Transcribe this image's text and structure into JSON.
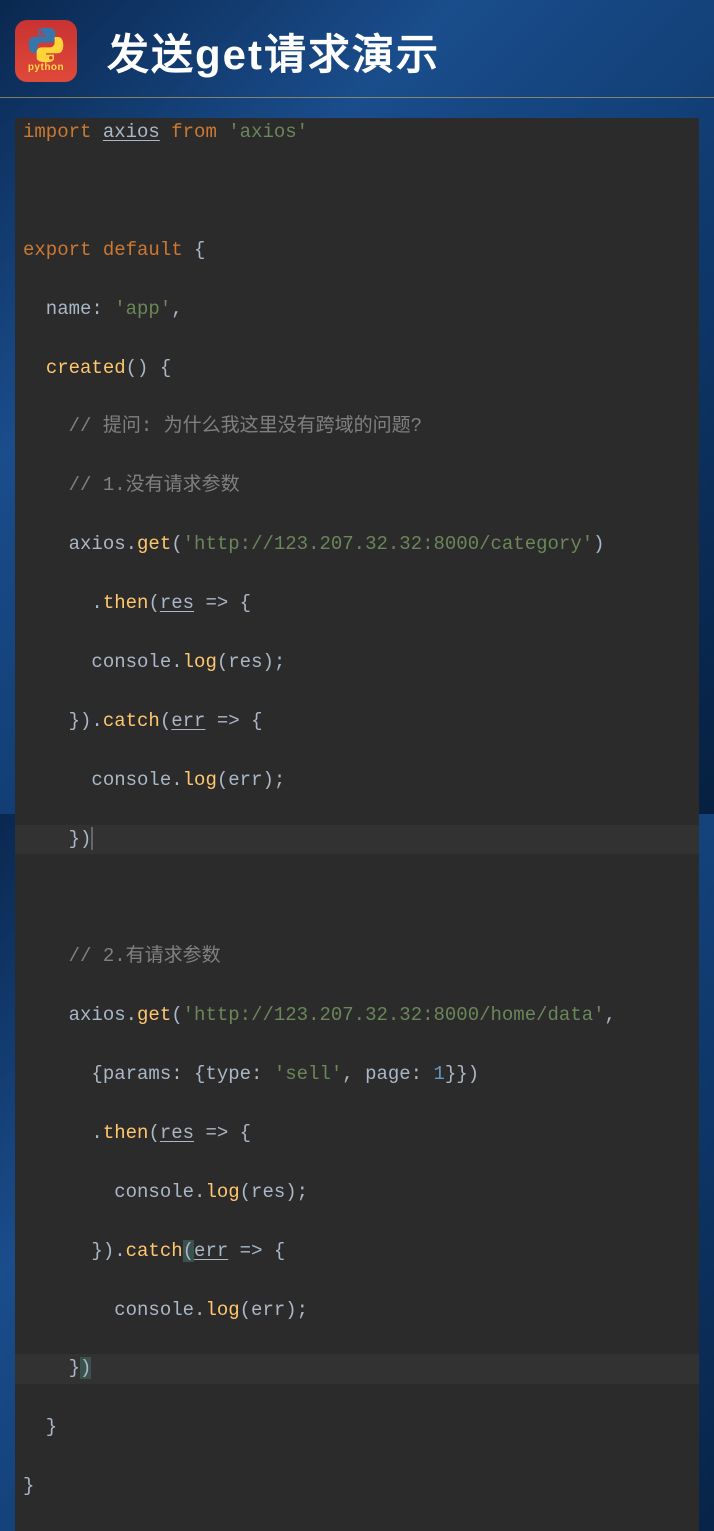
{
  "header": {
    "logo_text": "python",
    "title": "发送get请求演示"
  },
  "code": {
    "lines": [
      {
        "type": "code",
        "tokens": [
          {
            "cls": "kw",
            "t": "import "
          },
          {
            "cls": "ident underline",
            "t": "axios"
          },
          {
            "cls": "kw",
            "t": " from "
          },
          {
            "cls": "str",
            "t": "'axios'"
          }
        ]
      },
      {
        "type": "blank"
      },
      {
        "type": "code",
        "tokens": [
          {
            "cls": "kw",
            "t": "export default "
          },
          {
            "cls": "",
            "t": "{"
          }
        ]
      },
      {
        "type": "code",
        "tokens": [
          {
            "cls": "",
            "t": "  name: "
          },
          {
            "cls": "str",
            "t": "'app'"
          },
          {
            "cls": "",
            "t": ","
          }
        ]
      },
      {
        "type": "code",
        "tokens": [
          {
            "cls": "",
            "t": "  "
          },
          {
            "cls": "fn",
            "t": "created"
          },
          {
            "cls": "",
            "t": "() {"
          }
        ]
      },
      {
        "type": "code",
        "tokens": [
          {
            "cls": "",
            "t": "    "
          },
          {
            "cls": "cmt",
            "t": "// 提问: 为什么我这里没有跨域的问题?"
          }
        ]
      },
      {
        "type": "code",
        "tokens": [
          {
            "cls": "",
            "t": "    "
          },
          {
            "cls": "cmt",
            "t": "// 1.没有请求参数"
          }
        ]
      },
      {
        "type": "code",
        "tokens": [
          {
            "cls": "",
            "t": "    axios."
          },
          {
            "cls": "fn",
            "t": "get"
          },
          {
            "cls": "",
            "t": "("
          },
          {
            "cls": "str",
            "t": "'http://123.207.32.32:8000/category'"
          },
          {
            "cls": "",
            "t": ")"
          }
        ]
      },
      {
        "type": "code",
        "tokens": [
          {
            "cls": "",
            "t": "      ."
          },
          {
            "cls": "fn",
            "t": "then"
          },
          {
            "cls": "",
            "t": "("
          },
          {
            "cls": "param underline",
            "t": "res"
          },
          {
            "cls": "",
            "t": " => {"
          }
        ]
      },
      {
        "type": "code",
        "tokens": [
          {
            "cls": "",
            "t": "      console."
          },
          {
            "cls": "fn",
            "t": "log"
          },
          {
            "cls": "",
            "t": "(res);"
          }
        ]
      },
      {
        "type": "code",
        "tokens": [
          {
            "cls": "",
            "t": "    })."
          },
          {
            "cls": "fn",
            "t": "catch"
          },
          {
            "cls": "",
            "t": "("
          },
          {
            "cls": "param underline",
            "t": "err"
          },
          {
            "cls": "",
            "t": " => {"
          }
        ]
      },
      {
        "type": "code",
        "tokens": [
          {
            "cls": "",
            "t": "      console."
          },
          {
            "cls": "fn",
            "t": "log"
          },
          {
            "cls": "",
            "t": "(err);"
          }
        ]
      },
      {
        "type": "code",
        "hl": true,
        "tokens": [
          {
            "cls": "",
            "t": "    })"
          },
          {
            "cls": "cursor",
            "t": " "
          }
        ]
      },
      {
        "type": "blank"
      },
      {
        "type": "code",
        "tokens": [
          {
            "cls": "",
            "t": "    "
          },
          {
            "cls": "cmt",
            "t": "// 2.有请求参数"
          }
        ]
      },
      {
        "type": "code",
        "tokens": [
          {
            "cls": "",
            "t": "    axios."
          },
          {
            "cls": "fn",
            "t": "get"
          },
          {
            "cls": "",
            "t": "("
          },
          {
            "cls": "str",
            "t": "'http://123.207.32.32:8000/home/data'"
          },
          {
            "cls": "",
            "t": ","
          }
        ]
      },
      {
        "type": "code",
        "tokens": [
          {
            "cls": "",
            "t": "      {params: {type: "
          },
          {
            "cls": "str",
            "t": "'sell'"
          },
          {
            "cls": "",
            "t": ", page: "
          },
          {
            "cls": "num",
            "t": "1"
          },
          {
            "cls": "",
            "t": "}})"
          }
        ]
      },
      {
        "type": "code",
        "tokens": [
          {
            "cls": "",
            "t": "      ."
          },
          {
            "cls": "fn",
            "t": "then"
          },
          {
            "cls": "",
            "t": "("
          },
          {
            "cls": "param underline",
            "t": "res"
          },
          {
            "cls": "",
            "t": " => {"
          }
        ]
      },
      {
        "type": "code",
        "tokens": [
          {
            "cls": "",
            "t": "        console."
          },
          {
            "cls": "fn",
            "t": "log"
          },
          {
            "cls": "",
            "t": "(res);"
          }
        ]
      },
      {
        "type": "code",
        "tokens": [
          {
            "cls": "",
            "t": "      })."
          },
          {
            "cls": "fn",
            "t": "catch"
          },
          {
            "cls": "hl-paren",
            "t": "("
          },
          {
            "cls": "param underline",
            "t": "err"
          },
          {
            "cls": "",
            "t": " => {"
          }
        ]
      },
      {
        "type": "code",
        "tokens": [
          {
            "cls": "",
            "t": "        console."
          },
          {
            "cls": "fn",
            "t": "log"
          },
          {
            "cls": "",
            "t": "(err);"
          }
        ]
      },
      {
        "type": "code",
        "hl": true,
        "tokens": [
          {
            "cls": "",
            "t": "    }"
          },
          {
            "cls": "hl-paren",
            "t": ")"
          }
        ]
      },
      {
        "type": "code",
        "tokens": [
          {
            "cls": "",
            "t": "  }"
          }
        ]
      },
      {
        "type": "code",
        "tokens": [
          {
            "cls": "",
            "t": "}"
          }
        ]
      }
    ]
  }
}
